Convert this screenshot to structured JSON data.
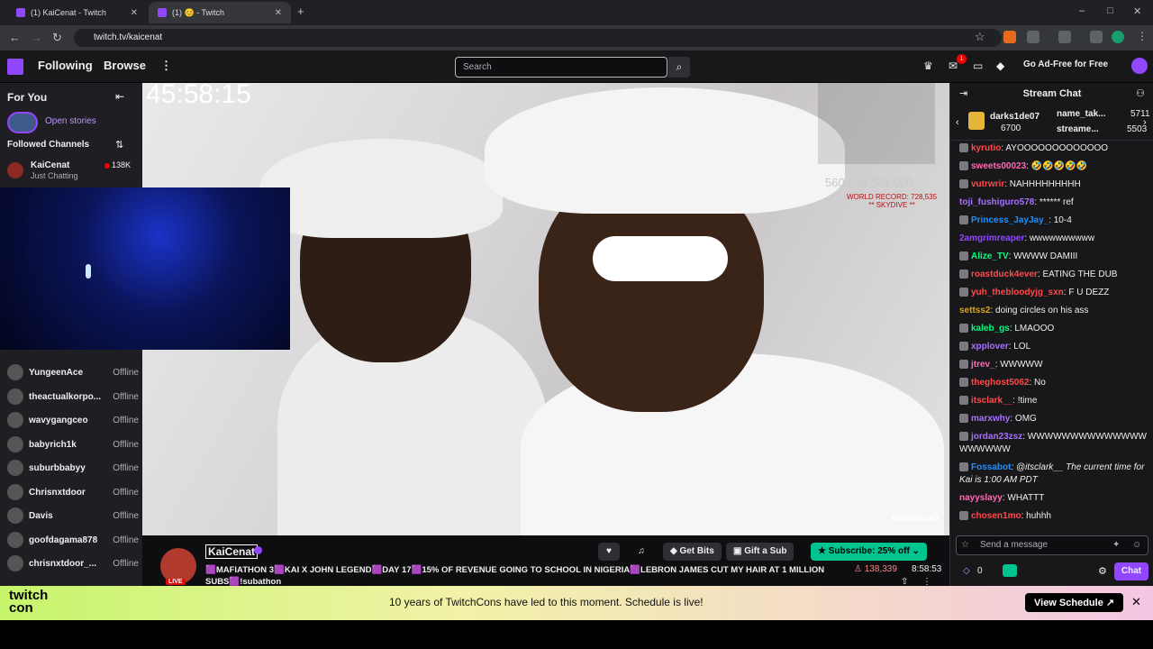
{
  "browser": {
    "tabs": [
      {
        "title": "(1) KaiCenat - Twitch"
      },
      {
        "title": "(1) 😊 - Twitch"
      }
    ],
    "new_tab": "+",
    "url": "twitch.tv/kaicenat"
  },
  "topnav": {
    "following": "Following",
    "browse": "Browse",
    "more": "⋮",
    "search_placeholder": "Search",
    "notif_count": "1",
    "ad_free": "Go Ad-Free for Free"
  },
  "sidebar": {
    "for_you": "For You",
    "open_stories": "Open stories",
    "followed_channels": "Followed Channels",
    "live_channel": {
      "name": "KaiCenat",
      "category": "Just Chatting",
      "viewers": "138K"
    },
    "offline_channels": [
      {
        "name": "YungeenAce",
        "status": "Offline"
      },
      {
        "name": "theactualkorpo...",
        "status": "Offline"
      },
      {
        "name": "wavygangceo",
        "status": "Offline"
      },
      {
        "name": "babyrich1k",
        "status": "Offline"
      },
      {
        "name": "suburbbabyy",
        "status": "Offline"
      },
      {
        "name": "Chrisnxtdoor",
        "status": "Offline"
      },
      {
        "name": "Davis",
        "status": "Offline"
      },
      {
        "name": "goofdagama878",
        "status": "Offline"
      },
      {
        "name": "chrisnxtdoor_...",
        "status": "Offline"
      }
    ]
  },
  "video": {
    "timer": "45:58:15",
    "overlay_total": "560,539,561,000",
    "world_record": "WORLD RECORD: 728,535",
    "skydive": "** SKYDIVE **",
    "watermark": "Mafiathon3"
  },
  "stream_info": {
    "streamer": "KaiCenat",
    "live": "LIVE",
    "title": "🟪MAFIATHON 3🟪KAI X JOHN LEGEND🟪DAY 17🟪15% OF REVENUE GOING TO SCHOOL IN NIGERIA🟪LEBRON JAMES CUT MY HAIR AT 1 MILLION SUBS🟪!subathon",
    "get_bits": "Get Bits",
    "gift_sub": "Gift a Sub",
    "subscribe": "Subscribe: 25% off",
    "viewers": "138,339",
    "uptime": "8:58:53"
  },
  "chat": {
    "title": "Stream Chat",
    "leaderboard": [
      {
        "name": "darks1de07",
        "amount": "6700"
      },
      {
        "name": "name_tak...",
        "amount": "5711"
      },
      {
        "name": "streame...",
        "amount": "5503"
      }
    ],
    "messages": [
      {
        "user": "kyrutio",
        "text": ": AYOOOOOOOOOOOOO",
        "color": "#ff4a4a"
      },
      {
        "user": "sweets00023",
        "text": ": 🤣🤣🤣🤣🤣",
        "color": "#ff69b4"
      },
      {
        "user": "vutrwrir",
        "text": ": NAHHHHHHHHH",
        "color": "#ff4a4a"
      },
      {
        "user": "toji_fushiguro578",
        "text": ": ****** ref",
        "color": "#a970ff"
      },
      {
        "user": "Princess_JayJay_",
        "text": ": 10-4",
        "color": "#1e90ff"
      },
      {
        "user": "2amgrimreaper",
        "text": ": wwwwwwwwww",
        "color": "#9147ff"
      },
      {
        "user": "Alize_TV",
        "text": ": WWWW DAMIII",
        "color": "#00ff7f"
      },
      {
        "user": "roastduck4ever",
        "text": ": EATING THE DUB",
        "color": "#ff4a4a"
      },
      {
        "user": "yuh_thebloodyjg_sxn",
        "text": ": F U DEZZ",
        "color": "#ff4a4a"
      },
      {
        "user": "settss2",
        "text": ": doing circles on his ass",
        "color": "#daa520"
      },
      {
        "user": "kaleb_gs",
        "text": ": LMAOOO",
        "color": "#00ff7f"
      },
      {
        "user": "xpplover",
        "text": ": LOL",
        "color": "#a970ff"
      },
      {
        "user": "jtrev_",
        "text": ": WWWWW",
        "color": "#ff69b4"
      },
      {
        "user": "theghost5062",
        "text": ": No",
        "color": "#ff4a4a"
      },
      {
        "user": "itsclark__",
        "text": ": !time",
        "color": "#ff4a4a"
      },
      {
        "user": "marxwhy",
        "text": ": OMG",
        "color": "#a970ff"
      },
      {
        "user": "jordan23zsz",
        "text": ": WWWWWWWWWWWWWWWWWWWW",
        "color": "#a970ff"
      },
      {
        "user": "Fossabot",
        "text": ": @itsclark__ The current time for Kai is 1:00 AM PDT",
        "color": "#1e90ff"
      },
      {
        "user": "nayyslayy",
        "text": ": WHATTT",
        "color": "#ff69b4"
      },
      {
        "user": "chosen1mo",
        "text": ": huhhh",
        "color": "#ff4a4a"
      }
    ],
    "input_placeholder": "Send a message",
    "points": "0",
    "chat_button": "Chat"
  },
  "banner": {
    "logo_line1": "twitch",
    "logo_line2": "con",
    "text": "10 years of TwitchCons have led to this moment. Schedule is live!",
    "button": "View Schedule ↗",
    "close": "✕"
  },
  "colors": {
    "twitch_purple": "#9147ff",
    "sub_green": "#00c48f",
    "live_red": "#eb0400"
  }
}
